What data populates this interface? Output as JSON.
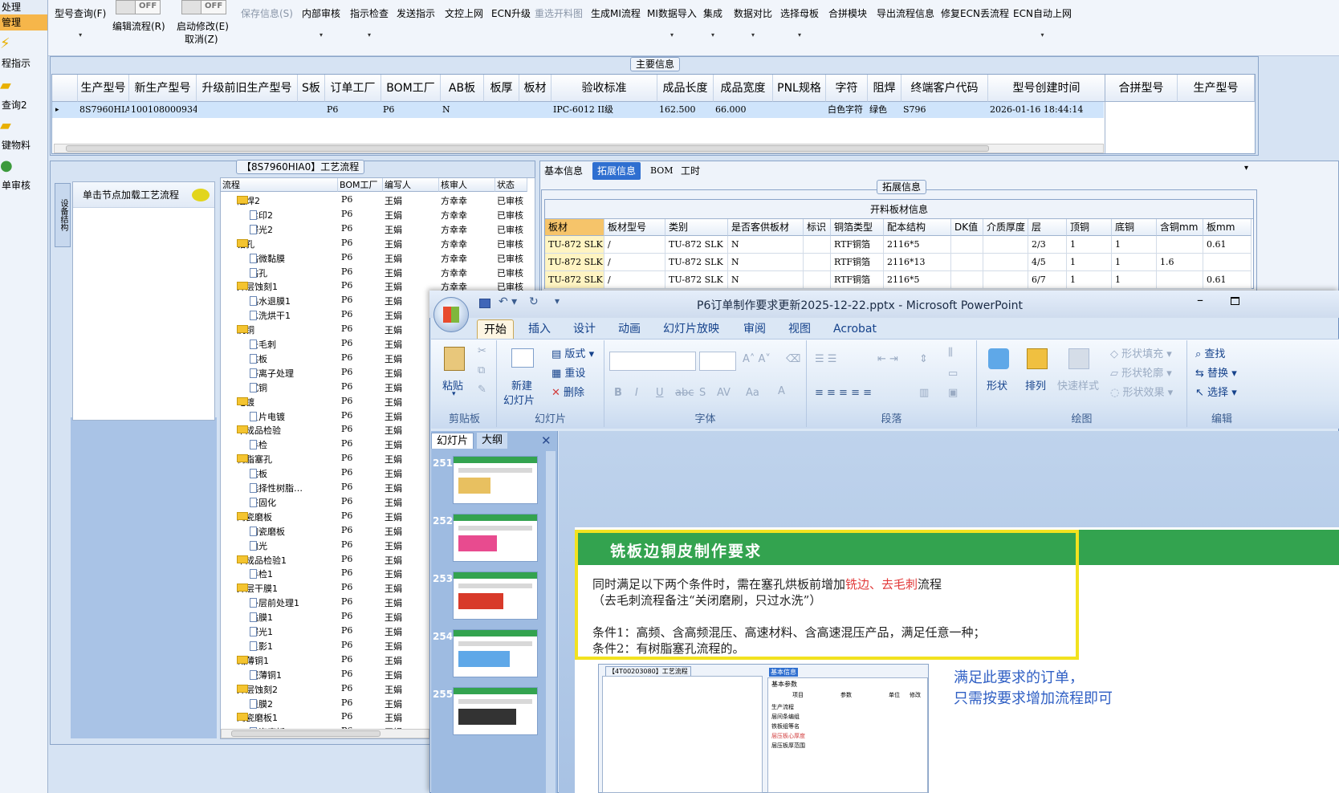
{
  "nav": {
    "top_label": "处理",
    "selected": "管理",
    "items": [
      "程指示",
      "查询2",
      "键物料",
      "单审核"
    ]
  },
  "toolbar": {
    "model_query": "型号查询(F)",
    "toggle1_text": "OFF",
    "toggle1_label": "编辑流程(R)",
    "toggle2_text": "OFF",
    "toggle2_label": "启动修改(E)",
    "cancel": "取消(Z)",
    "save_info": "保存信息(S)",
    "items": [
      "内部审核",
      "指示检查",
      "发送指示",
      "文控上网",
      "ECN升级",
      "重选开料图",
      "生成MI流程",
      "MI数据导入",
      "集成",
      "数据对比",
      "选择母板",
      "合拼模块",
      "导出流程信息",
      "修复ECN丢流程",
      "ECN自动上网"
    ]
  },
  "main_info": {
    "title": "主要信息",
    "columns": [
      "生产型号",
      "新生产型号",
      "升级前旧生产型号",
      "S板",
      "订单工厂",
      "BOM工厂",
      "AB板",
      "板厚",
      "板材",
      "验收标准",
      "成品长度",
      "成品宽度",
      "PNL规格",
      "字符",
      "阻焊",
      "终端客户代码",
      "型号创建时间"
    ],
    "row": [
      "8S7960HIA0",
      "10010800093424",
      "",
      "",
      "P6",
      "P6",
      "N",
      "",
      "",
      "IPC-6012 II级",
      "162.500",
      "66.000",
      "",
      "白色字符",
      "绿色",
      "S796",
      "2026-01-16 18:44:14"
    ],
    "side_columns": [
      "合拼型号",
      "生产型号"
    ]
  },
  "process": {
    "title": "【8S7960HIA0】工艺流程",
    "vtab": "设备结构",
    "load_hint": "单击节点加载工艺流程",
    "columns": [
      "流程",
      "BOM工厂",
      "编写人",
      "核审人",
      "状态"
    ],
    "rows": [
      {
        "name": "阻焊2",
        "type": "folder",
        "f": "P6",
        "w": "王娟",
        "r": "方幸幸",
        "s": "已审核"
      },
      {
        "name": "丝印2",
        "type": "doc",
        "f": "P6",
        "w": "王娟",
        "r": "方幸幸",
        "s": "已审核"
      },
      {
        "name": "曝光2",
        "type": "doc",
        "f": "P6",
        "w": "王娟",
        "r": "方幸幸",
        "s": "已审核"
      },
      {
        "name": "钻孔",
        "type": "folder",
        "f": "P6",
        "w": "王娟",
        "r": "方幸幸",
        "s": "已审核"
      },
      {
        "name": "钻微黏膜",
        "type": "doc",
        "f": "P6",
        "w": "王娟",
        "r": "方幸幸",
        "s": "已审核"
      },
      {
        "name": "钻孔",
        "type": "doc",
        "f": "P6",
        "w": "王娟",
        "r": "方幸幸",
        "s": "已审核"
      },
      {
        "name": "外层蚀刻1",
        "type": "folder",
        "f": "P6",
        "w": "王娟",
        "r": "方幸幸",
        "s": "已审核"
      },
      {
        "name": "热水退膜1",
        "type": "doc",
        "f": "P6",
        "w": "王娟",
        "r": "",
        "s": ""
      },
      {
        "name": "水洗烘干1",
        "type": "doc",
        "f": "P6",
        "w": "王娟",
        "r": "",
        "s": ""
      },
      {
        "name": "沉铜",
        "type": "folder",
        "f": "P6",
        "w": "王娟",
        "r": "",
        "s": ""
      },
      {
        "name": "去毛刺",
        "type": "doc",
        "f": "P6",
        "w": "王娟",
        "r": "",
        "s": ""
      },
      {
        "name": "烘板",
        "type": "doc",
        "f": "P6",
        "w": "王娟",
        "r": "",
        "s": ""
      },
      {
        "name": "等离子处理",
        "type": "doc",
        "f": "P6",
        "w": "王娟",
        "r": "",
        "s": ""
      },
      {
        "name": "沉铜",
        "type": "doc",
        "f": "P6",
        "w": "王娟",
        "r": "",
        "s": ""
      },
      {
        "name": "电镀",
        "type": "folder",
        "f": "P6",
        "w": "王娟",
        "r": "",
        "s": ""
      },
      {
        "name": "负片电镀",
        "type": "doc",
        "f": "P6",
        "w": "王娟",
        "r": "",
        "s": ""
      },
      {
        "name": "半成品检验",
        "type": "folder",
        "f": "P6",
        "w": "王娟",
        "r": "",
        "s": ""
      },
      {
        "name": "半检",
        "type": "doc",
        "f": "P6",
        "w": "王娟",
        "r": "",
        "s": ""
      },
      {
        "name": "树脂塞孔",
        "type": "folder",
        "f": "P6",
        "w": "王娟",
        "r": "",
        "s": ""
      },
      {
        "name": "烘板",
        "type": "doc",
        "f": "P6",
        "w": "王娟",
        "r": "",
        "s": ""
      },
      {
        "name": "选择性树脂…",
        "type": "doc",
        "f": "P6",
        "w": "王娟",
        "r": "",
        "s": ""
      },
      {
        "name": "终固化",
        "type": "doc",
        "f": "P6",
        "w": "王娟",
        "r": "",
        "s": ""
      },
      {
        "name": "陶瓷磨板",
        "type": "folder",
        "f": "P6",
        "w": "王娟",
        "r": "",
        "s": ""
      },
      {
        "name": "陶瓷磨板",
        "type": "doc",
        "f": "P6",
        "w": "王娟",
        "r": "",
        "s": ""
      },
      {
        "name": "抛光",
        "type": "doc",
        "f": "P6",
        "w": "王娟",
        "r": "",
        "s": ""
      },
      {
        "name": "半成品检验1",
        "type": "folder",
        "f": "P6",
        "w": "王娟",
        "r": "",
        "s": ""
      },
      {
        "name": "半检1",
        "type": "doc",
        "f": "P6",
        "w": "王娟",
        "r": "",
        "s": ""
      },
      {
        "name": "外层干膜1",
        "type": "folder",
        "f": "P6",
        "w": "王娟",
        "r": "",
        "s": ""
      },
      {
        "name": "外层前处理1",
        "type": "doc",
        "f": "P6",
        "w": "王娟",
        "r": "",
        "s": ""
      },
      {
        "name": "贴膜1",
        "type": "doc",
        "f": "P6",
        "w": "王娟",
        "r": "",
        "s": ""
      },
      {
        "name": "曝光1",
        "type": "doc",
        "f": "P6",
        "w": "王娟",
        "r": "",
        "s": ""
      },
      {
        "name": "显影1",
        "type": "doc",
        "f": "P6",
        "w": "王娟",
        "r": "",
        "s": ""
      },
      {
        "name": "减薄铜1",
        "type": "folder",
        "f": "P6",
        "w": "王娟",
        "r": "",
        "s": ""
      },
      {
        "name": "减薄铜1",
        "type": "doc",
        "f": "P6",
        "w": "王娟",
        "r": "",
        "s": ""
      },
      {
        "name": "外层蚀刻2",
        "type": "folder",
        "f": "P6",
        "w": "王娟",
        "r": "",
        "s": ""
      },
      {
        "name": "退膜2",
        "type": "doc",
        "f": "P6",
        "w": "王娟",
        "r": "",
        "s": ""
      },
      {
        "name": "陶瓷磨板1",
        "type": "folder",
        "f": "P6",
        "w": "王娟",
        "r": "",
        "s": ""
      },
      {
        "name": "陶瓷磨板1",
        "type": "doc",
        "f": "P6",
        "w": "王娟",
        "r": "",
        "s": ""
      }
    ]
  },
  "right_tabs": [
    "基本信息",
    "拓展信息",
    "BOM",
    "工时"
  ],
  "ext": {
    "group": "拓展信息",
    "table_title": "开料板材信息",
    "columns": [
      "板材",
      "板材型号",
      "类别",
      "是否客供板材",
      "标识",
      "铜箔类型",
      "配本结构",
      "DK值",
      "介质厚度",
      "层",
      "顶铜",
      "底铜",
      "含铜mm",
      "板mm"
    ],
    "rows": [
      [
        "TU-872 SLK",
        "/",
        "TU-872 SLK",
        "N",
        "",
        "RTF铜箔",
        "2116*5",
        "",
        "",
        "2/3",
        "1",
        "1",
        "",
        "0.61"
      ],
      [
        "TU-872 SLK",
        "/",
        "TU-872 SLK",
        "N",
        "",
        "RTF铜箔",
        "2116*13",
        "",
        "",
        "4/5",
        "1",
        "1",
        "1.6",
        ""
      ],
      [
        "TU-872 SLK",
        "/",
        "TU-872 SLK",
        "N",
        "",
        "RTF铜箔",
        "2116*5",
        "",
        "",
        "6/7",
        "1",
        "1",
        "",
        "0.61"
      ]
    ]
  },
  "ppt": {
    "title": "P6订单制作要求更新2025-12-22.pptx - Microsoft PowerPoint",
    "tabs": [
      "开始",
      "插入",
      "设计",
      "动画",
      "幻灯片放映",
      "审阅",
      "视图",
      "Acrobat"
    ],
    "paste": "粘贴",
    "new_slide_1": "新建",
    "new_slide_2": "幻灯片",
    "layout": "版式",
    "reset": "重设",
    "delete": "删除",
    "shape": "形状",
    "arrange": "排列",
    "quick_style": "快速样式",
    "shape_fill": "形状填充",
    "shape_outline": "形状轮廓",
    "shape_effect": "形状效果",
    "find": "查找",
    "replace": "替换",
    "select": "选择",
    "groups": [
      "剪贴板",
      "幻灯片",
      "字体",
      "段落",
      "绘图",
      "编辑"
    ],
    "pane_tabs": [
      "幻灯片",
      "大纲"
    ],
    "thumbs": [
      "251",
      "252",
      "253",
      "254",
      "255"
    ],
    "slide": {
      "title": "铣板边铜皮制作要求",
      "line1_a": "同时满足以下两个条件时，需在塞孔烘板前增加",
      "line1_red": "铣边、去毛刺",
      "line1_b": "流程",
      "line2": "（去毛刺流程备注“关闭磨刷，只过水洗”）",
      "cond1": "条件1：高频、含高频混压、高速材料、含高速混压产品，满足任意一种；",
      "cond2": "条件2：有树脂塞孔流程的。",
      "note1": "满足此要求的订单，",
      "note2": "只需按要求增加流程即可",
      "shot_title": "【4T00203080】工艺流程",
      "shot_tab": "基本信息",
      "shot_tab2": "基本参数",
      "shot_cols": [
        "项目",
        "参数",
        "单位",
        "修改"
      ],
      "shot_rows": [
        "生产流程",
        "层间条编组",
        "铁板组等名",
        "层压板心厚度",
        "层压板厚范围"
      ]
    }
  }
}
